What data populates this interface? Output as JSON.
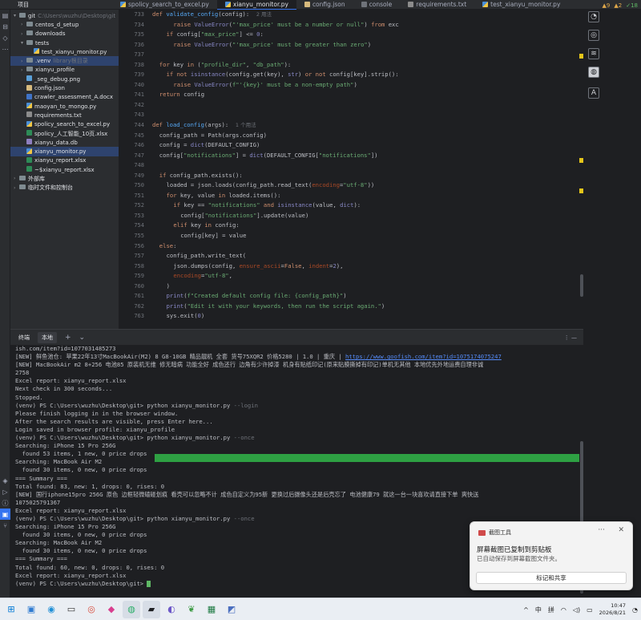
{
  "tabs": {
    "project_label": "项目",
    "items": [
      {
        "label": "spolicy_search_to_excel.py",
        "kind": "py"
      },
      {
        "label": "xianyu_monitor.py",
        "kind": "py",
        "active": true
      },
      {
        "label": "config.json",
        "kind": "js"
      },
      {
        "label": "console",
        "kind": "con"
      },
      {
        "label": "requirements.txt",
        "kind": "txt"
      },
      {
        "label": "test_xianyu_monitor.py",
        "kind": "py"
      }
    ]
  },
  "tree": [
    {
      "label": "git",
      "hint": "C:\\Users\\wuzhu\\Desktop\\git",
      "level": 0,
      "arrow": "▾",
      "type": "folder"
    },
    {
      "label": "centos_d_setup",
      "level": 1,
      "arrow": "›",
      "type": "folder"
    },
    {
      "label": "downloads",
      "level": 1,
      "arrow": "›",
      "type": "folder"
    },
    {
      "label": "tests",
      "level": 1,
      "arrow": "▾",
      "type": "folder"
    },
    {
      "label": "test_xianyu_monitor.py",
      "level": 2,
      "type": "py"
    },
    {
      "label": ".venv",
      "hint": "library根目录",
      "level": 1,
      "arrow": "›",
      "type": "folder",
      "sel": true
    },
    {
      "label": "xianyu_profile",
      "level": 1,
      "arrow": "›",
      "type": "folder"
    },
    {
      "label": "_seg_debug.png",
      "level": 1,
      "type": "png"
    },
    {
      "label": "config.json",
      "level": 1,
      "type": "js"
    },
    {
      "label": "crawler_assessment_A.docx",
      "level": 1,
      "type": "doc"
    },
    {
      "label": "maoyan_to_mongo.py",
      "level": 1,
      "type": "py"
    },
    {
      "label": "requirements.txt",
      "level": 1,
      "type": "txt"
    },
    {
      "label": "spolicy_search_to_excel.py",
      "level": 1,
      "type": "py"
    },
    {
      "label": "spolicy_人工智能_10页.xlsx",
      "level": 1,
      "type": "xlsx"
    },
    {
      "label": "xianyu_data.db",
      "level": 1,
      "type": "db"
    },
    {
      "label": "xianyu_monitor.py",
      "level": 1,
      "type": "py",
      "sel": true
    },
    {
      "label": "xianyu_report.xlsx",
      "level": 1,
      "type": "xlsx"
    },
    {
      "label": "~$xianyu_report.xlsx",
      "level": 1,
      "type": "xlsx"
    },
    {
      "label": "外部库",
      "level": 0,
      "arrow": "›",
      "type": "lib"
    },
    {
      "label": "临时文件和控制台",
      "level": 0,
      "arrow": "›",
      "type": "lib"
    }
  ],
  "inspections": {
    "warnings": "9",
    "weak": "2",
    "ok": "18"
  },
  "editor": {
    "lines": [
      {
        "n": "733",
        "parts": [
          [
            "kw",
            "def "
          ],
          [
            "fn",
            "validate_config"
          ],
          [
            "",
            "(config):  "
          ],
          [
            "hint",
            "2 用法"
          ]
        ],
        "indent": 0
      },
      {
        "n": "734",
        "parts": [
          [
            "kw",
            "raise "
          ],
          [
            "bi",
            "ValueError"
          ],
          [
            "",
            "("
          ],
          [
            "st",
            "\"'max_price' must be a number or null\""
          ],
          [
            "",
            ") "
          ],
          [
            "kw",
            "from "
          ],
          [
            "",
            "exc"
          ]
        ],
        "indent": 6
      },
      {
        "n": "735",
        "parts": [
          [
            "kw",
            "if "
          ],
          [
            "",
            "config["
          ],
          [
            "st",
            "\"max_price\""
          ],
          [
            "",
            "] <= "
          ],
          [
            "bi",
            "0"
          ],
          [
            "",
            ":"
          ]
        ],
        "indent": 4
      },
      {
        "n": "736",
        "parts": [
          [
            "kw",
            "raise "
          ],
          [
            "bi",
            "ValueError"
          ],
          [
            "",
            "("
          ],
          [
            "st",
            "\"'max_price' must be greater than zero\""
          ],
          [
            "",
            ")"
          ]
        ],
        "indent": 6
      },
      {
        "n": "737",
        "parts": [],
        "indent": 0
      },
      {
        "n": "738",
        "parts": [
          [
            "kw",
            "for "
          ],
          [
            "",
            "key "
          ],
          [
            "kw",
            "in "
          ],
          [
            "",
            "("
          ],
          [
            "st",
            "\"profile_dir\""
          ],
          [
            "",
            ", "
          ],
          [
            "st",
            "\"db_path\""
          ],
          [
            "",
            "):"
          ]
        ],
        "indent": 2
      },
      {
        "n": "739",
        "parts": [
          [
            "kw",
            "if not "
          ],
          [
            "bi",
            "isinstance"
          ],
          [
            "",
            "(config.get(key), "
          ],
          [
            "bi",
            "str"
          ],
          [
            "",
            ") "
          ],
          [
            "kw",
            "or not "
          ],
          [
            "",
            "config[key].strip():"
          ]
        ],
        "indent": 4
      },
      {
        "n": "740",
        "parts": [
          [
            "kw",
            "raise "
          ],
          [
            "bi",
            "ValueError"
          ],
          [
            "",
            "("
          ],
          [
            "st",
            "f\"'{key}' must be a non-empty path\""
          ],
          [
            "",
            ")"
          ]
        ],
        "indent": 6
      },
      {
        "n": "741",
        "parts": [
          [
            "kw",
            "return "
          ],
          [
            "",
            "config"
          ]
        ],
        "indent": 2
      },
      {
        "n": "742",
        "parts": [],
        "indent": 0
      },
      {
        "n": "743",
        "parts": [],
        "indent": 0
      },
      {
        "n": "744",
        "parts": [
          [
            "kw",
            "def "
          ],
          [
            "fn",
            "load_config"
          ],
          [
            "",
            "(args):  "
          ],
          [
            "hint",
            "1 个用法"
          ]
        ],
        "indent": 0
      },
      {
        "n": "745",
        "parts": [
          [
            "",
            "config_path = Path(args.config)"
          ]
        ],
        "indent": 2
      },
      {
        "n": "746",
        "parts": [
          [
            "",
            "config = "
          ],
          [
            "bi",
            "dict"
          ],
          [
            "",
            "(DEFAULT_CONFIG)"
          ]
        ],
        "indent": 2
      },
      {
        "n": "747",
        "parts": [
          [
            "",
            "config["
          ],
          [
            "st",
            "\"notifications\""
          ],
          [
            "",
            "] = "
          ],
          [
            "bi",
            "dict"
          ],
          [
            "",
            "(DEFAULT_CONFIG["
          ],
          [
            "st",
            "\"notifications\""
          ],
          [
            "",
            "])"
          ]
        ],
        "indent": 2
      },
      {
        "n": "748",
        "parts": [],
        "indent": 0
      },
      {
        "n": "749",
        "parts": [
          [
            "kw",
            "if "
          ],
          [
            "",
            "config_path.exists():"
          ]
        ],
        "indent": 2
      },
      {
        "n": "750",
        "parts": [
          [
            "",
            "loaded = json.loads(config_path.read_text("
          ],
          [
            "pm",
            "encoding"
          ],
          [
            "",
            "="
          ],
          [
            "st",
            "\"utf-8\""
          ],
          [
            "",
            "))"
          ]
        ],
        "indent": 4
      },
      {
        "n": "751",
        "parts": [
          [
            "kw",
            "for "
          ],
          [
            "",
            "key, value "
          ],
          [
            "kw",
            "in "
          ],
          [
            "",
            "loaded.items():"
          ]
        ],
        "indent": 4
      },
      {
        "n": "752",
        "parts": [
          [
            "kw",
            "if "
          ],
          [
            "",
            "key == "
          ],
          [
            "st",
            "\"notifications\" "
          ],
          [
            "kw",
            "and "
          ],
          [
            "bi",
            "isinstance"
          ],
          [
            "",
            "(value, "
          ],
          [
            "bi",
            "dict"
          ],
          [
            "",
            "):"
          ]
        ],
        "indent": 6
      },
      {
        "n": "753",
        "parts": [
          [
            "",
            "config["
          ],
          [
            "st",
            "\"notifications\""
          ],
          [
            "",
            "].update(value)"
          ]
        ],
        "indent": 8
      },
      {
        "n": "754",
        "parts": [
          [
            "kw",
            "elif "
          ],
          [
            "",
            "key "
          ],
          [
            "kw",
            "in "
          ],
          [
            "",
            "config:"
          ]
        ],
        "indent": 6
      },
      {
        "n": "755",
        "parts": [
          [
            "",
            "config[key] = value"
          ]
        ],
        "indent": 8
      },
      {
        "n": "756",
        "parts": [
          [
            "kw",
            "else"
          ],
          [
            "",
            ":"
          ]
        ],
        "indent": 2
      },
      {
        "n": "757",
        "parts": [
          [
            "",
            "config_path.write_text("
          ]
        ],
        "indent": 4
      },
      {
        "n": "758",
        "parts": [
          [
            "",
            "json.dumps(config, "
          ],
          [
            "pm",
            "ensure_ascii"
          ],
          [
            "",
            "="
          ],
          [
            "kw",
            "False"
          ],
          [
            "",
            ", "
          ],
          [
            "pm",
            "indent"
          ],
          [
            "",
            "="
          ],
          [
            "bi",
            "2"
          ],
          [
            "",
            "),"
          ]
        ],
        "indent": 6
      },
      {
        "n": "759",
        "parts": [
          [
            "pm",
            "encoding"
          ],
          [
            "",
            "="
          ],
          [
            "st",
            "\"utf-8\""
          ],
          [
            "",
            ","
          ]
        ],
        "indent": 6
      },
      {
        "n": "760",
        "parts": [
          [
            "",
            ")"
          ]
        ],
        "indent": 4
      },
      {
        "n": "761",
        "parts": [
          [
            "bi",
            "print"
          ],
          [
            "",
            "("
          ],
          [
            "st",
            "f\"Created default config file: {config_path}\""
          ],
          [
            "",
            ")"
          ]
        ],
        "indent": 4
      },
      {
        "n": "762",
        "parts": [
          [
            "bi",
            "print"
          ],
          [
            "",
            "("
          ],
          [
            "st",
            "\"Edit it with your keywords, then run the script again.\""
          ],
          [
            "",
            ")"
          ]
        ],
        "indent": 4
      },
      {
        "n": "763",
        "parts": [
          [
            "",
            "sys.exit("
          ],
          [
            "bi",
            "0"
          ],
          [
            "",
            ")"
          ]
        ],
        "indent": 4
      }
    ]
  },
  "terminal": {
    "title": "终端",
    "tab": "本地",
    "add": "+",
    "dropdown": "⌄",
    "lines": [
      {
        "t": "ish.com/item?id=1077031485273"
      },
      {
        "t": "[NEW] 鲜鱼池仓: 苹果22年13寸MacBookAir(M2) 8 G8-10GB 精品靓机 全套 货号75XQR2 价格5280 | 1.0 | 重庆 | ",
        "link": "https://www.goofish.com/item?id=1075174075247"
      },
      {
        "t": "[NEW] MacBookAir m2 8+256 电池85 原装机无维 修无暗病 功能全好 成色还行 边角有少许掉漆 机身有贴纸印记(原来贴膜撕掉有印记)单机无其他 本地优先外地运费自理非诚"
      },
      {
        "t": "2758"
      },
      {
        "t": "Excel report: xianyu_report.xlsx"
      },
      {
        "t": "Next check in 300 seconds..."
      },
      {
        "t": "Stopped."
      },
      {
        "t": "(venv) PS C:\\Users\\wuzhu\\Desktop\\git> python xianyu_monitor.py ",
        "faint": "--login"
      },
      {
        "t": "Please finish logging in in the browser window."
      },
      {
        "t": "After the search results are visible, press Enter here..."
      },
      {
        "t": "Login saved in browser profile: xianyu_profile"
      },
      {
        "t": "(venv) PS C:\\Users\\wuzhu\\Desktop\\git> python xianyu_monitor.py ",
        "faint": "--once"
      },
      {
        "t": "Searching: iPhone 15 Pro 256G"
      },
      {
        "t": "  found 53 items, 1 new, 0 price drops"
      },
      {
        "t": "Searching: MacBook Air M2"
      },
      {
        "t": "  found 30 items, 0 new, 0 price drops"
      },
      {
        "t": "=== Summary ==="
      },
      {
        "t": "Total found: 83, new: 1, drops: 0, rises: 0"
      },
      {
        "t": "[NEW] 国行iphone15pro 256G 原色 边框轻微磕碰划痕 看壳可以忽略不计 成色自定义为95新 更换过后摄像头还是后壳忘了 电池健康79 就这一台一块喜欢请直接下单 爽快送"
      },
      {
        "t": "1075025791367"
      },
      {
        "t": "Excel report: xianyu_report.xlsx"
      },
      {
        "t": "(venv) PS C:\\Users\\wuzhu\\Desktop\\git> python xianyu_monitor.py ",
        "faint": "--once"
      },
      {
        "t": "Searching: iPhone 15 Pro 256G"
      },
      {
        "t": "  found 30 items, 0 new, 0 price drops"
      },
      {
        "t": "Searching: MacBook Air M2"
      },
      {
        "t": "  found 30 items, 0 new, 0 price drops"
      },
      {
        "t": "=== Summary ==="
      },
      {
        "t": "Total found: 60, new: 0, drops: 0, rises: 0"
      },
      {
        "t": "Excel report: xianyu_report.xlsx"
      },
      {
        "t": "(venv) PS C:\\Users\\wuzhu\\Desktop\\git> ",
        "cursor": true
      }
    ]
  },
  "toast": {
    "app": "截图工具",
    "more": "···",
    "close": "✕",
    "title": "屏幕截图已复制到剪贴板",
    "body": "已自动保存到屏幕截图文件夹。",
    "button": "标记和共享"
  },
  "taskbar": {
    "items": [
      {
        "name": "start-icon",
        "glyph": "⊞"
      },
      {
        "name": "photos-icon",
        "glyph": "▣"
      },
      {
        "name": "edge-icon",
        "glyph": "◉"
      },
      {
        "name": "terminal-icon",
        "glyph": "▭"
      },
      {
        "name": "chrome-icon",
        "glyph": "◎"
      },
      {
        "name": "jetbrains-icon",
        "glyph": "◆"
      },
      {
        "name": "wechat-icon",
        "glyph": "◍",
        "on": true
      },
      {
        "name": "pycharm-icon",
        "glyph": "▰",
        "on": true
      },
      {
        "name": "app-icon",
        "glyph": "◐"
      },
      {
        "name": "mongodb-icon",
        "glyph": "❦"
      },
      {
        "name": "excel-icon",
        "glyph": "▦"
      },
      {
        "name": "app2-icon",
        "glyph": "◩"
      }
    ],
    "tray": {
      "chevron": "^",
      "lang": "中",
      "ime": "拼",
      "clock_time": "10:47",
      "clock_date": "2026/8/21"
    }
  }
}
